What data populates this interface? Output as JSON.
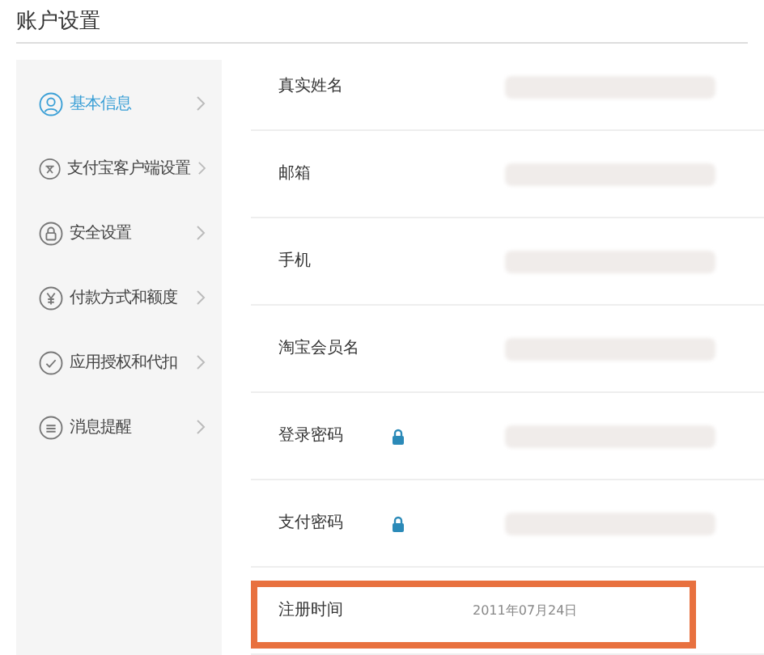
{
  "page_title": "账户设置",
  "sidebar": {
    "items": [
      {
        "label": "基本信息",
        "kind": "user",
        "selected": true
      },
      {
        "label": "支付宝客户端设置",
        "kind": "client",
        "selected": false
      },
      {
        "label": "安全设置",
        "kind": "lock",
        "selected": false
      },
      {
        "label": "付款方式和额度",
        "kind": "yen",
        "selected": false
      },
      {
        "label": "应用授权和代扣",
        "kind": "check",
        "selected": false
      },
      {
        "label": "消息提醒",
        "kind": "message",
        "selected": false
      }
    ]
  },
  "rows": [
    {
      "label": "真实姓名",
      "locked": false,
      "redacted": true,
      "highlighted": false
    },
    {
      "label": "邮箱",
      "locked": false,
      "redacted": true,
      "highlighted": false
    },
    {
      "label": "手机",
      "locked": false,
      "redacted": true,
      "highlighted": false
    },
    {
      "label": "淘宝会员名",
      "locked": false,
      "redacted": true,
      "highlighted": false
    },
    {
      "label": "登录密码",
      "locked": true,
      "redacted": true,
      "highlighted": false
    },
    {
      "label": "支付密码",
      "locked": true,
      "redacted": true,
      "highlighted": false
    },
    {
      "label": "注册时间",
      "locked": false,
      "redacted": false,
      "value": "2011年07月24日",
      "highlighted": true
    }
  ]
}
